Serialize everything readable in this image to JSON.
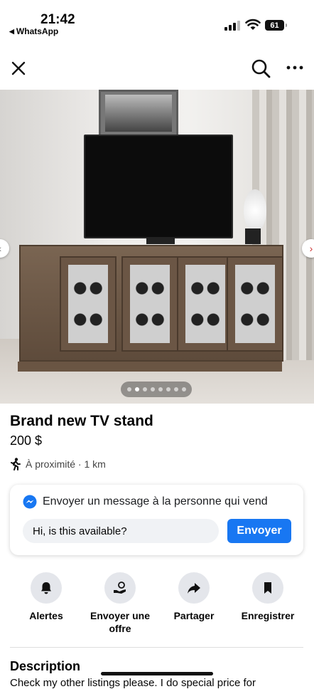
{
  "status_bar": {
    "time": "21:42",
    "back_app": "WhatsApp",
    "battery": "61"
  },
  "nav": {
    "close_icon": "close-icon",
    "search_icon": "search-icon",
    "more_icon": "more-icon"
  },
  "gallery": {
    "dot_count": 8,
    "active_dot": 1
  },
  "listing": {
    "title": "Brand new TV stand",
    "price": "200 $",
    "location": "À proximité · 1 km"
  },
  "message": {
    "heading": "Envoyer un message à la personne qui vend",
    "input_value": "Hi, is this available?",
    "send_label": "Envoyer"
  },
  "actions": [
    {
      "label": "Alertes",
      "icon": "bell-icon"
    },
    {
      "label": "Envoyer une offre",
      "icon": "offer-icon"
    },
    {
      "label": "Partager",
      "icon": "share-icon"
    },
    {
      "label": "Enregistrer",
      "icon": "bookmark-icon"
    }
  ],
  "description": {
    "title": "Description",
    "text": "Check my other listings please. I do special price for"
  },
  "colors": {
    "accent": "#1877f2",
    "icon_bg": "#e4e6eb"
  }
}
